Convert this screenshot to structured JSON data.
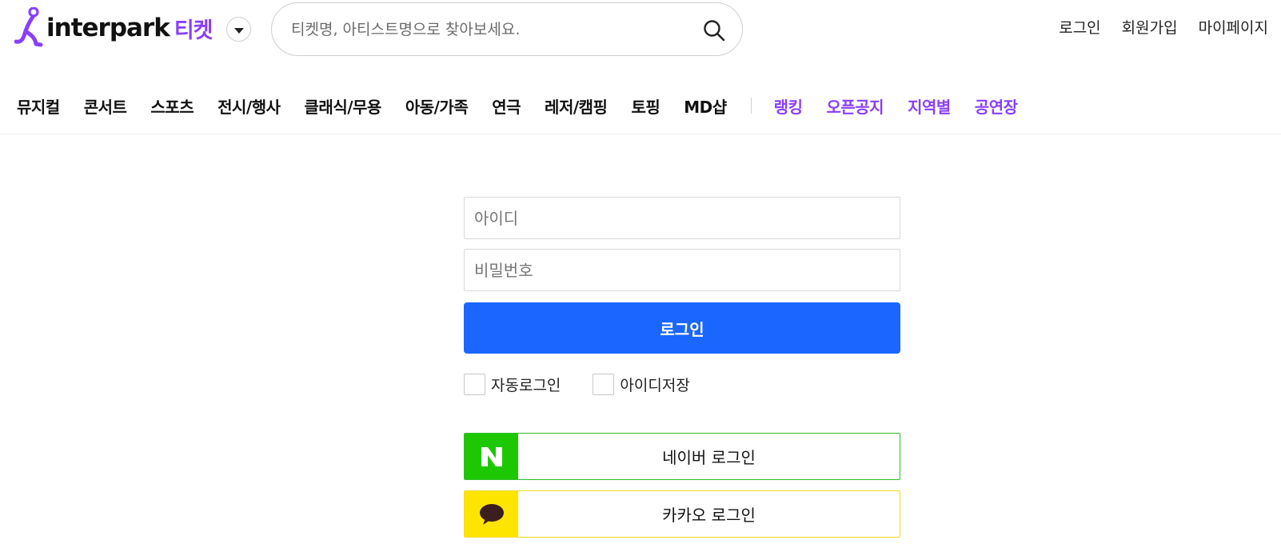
{
  "brand": {
    "wordmark": "interpark",
    "sub": "티켓",
    "accent_color": "#8a3ffc"
  },
  "search": {
    "placeholder": "티켓명, 아티스트명으로 찾아보세요.",
    "value": "",
    "icon": "search-icon"
  },
  "util_links": [
    "로그인",
    "회원가입",
    "마이페이지"
  ],
  "nav": {
    "categories": [
      "뮤지컬",
      "콘서트",
      "스포츠",
      "전시/행사",
      "클래식/무용",
      "아동/가족",
      "연극",
      "레저/캠핑",
      "토핑",
      "MD샵"
    ],
    "highlights": [
      "랭킹",
      "오픈공지",
      "지역별",
      "공연장"
    ]
  },
  "login": {
    "id_placeholder": "아이디",
    "pw_placeholder": "비밀번호",
    "submit": "로그인",
    "submit_color": "#1a66ff",
    "auto_login": "자동로그인",
    "save_id": "아이디저장"
  },
  "social": {
    "naver": {
      "label": "네이버 로그인",
      "icon": "naver-n-icon",
      "color": "#1ec800"
    },
    "kakao": {
      "label": "카카오 로그인",
      "icon": "kakao-speech-bubble-icon",
      "color": "#fee500"
    }
  }
}
